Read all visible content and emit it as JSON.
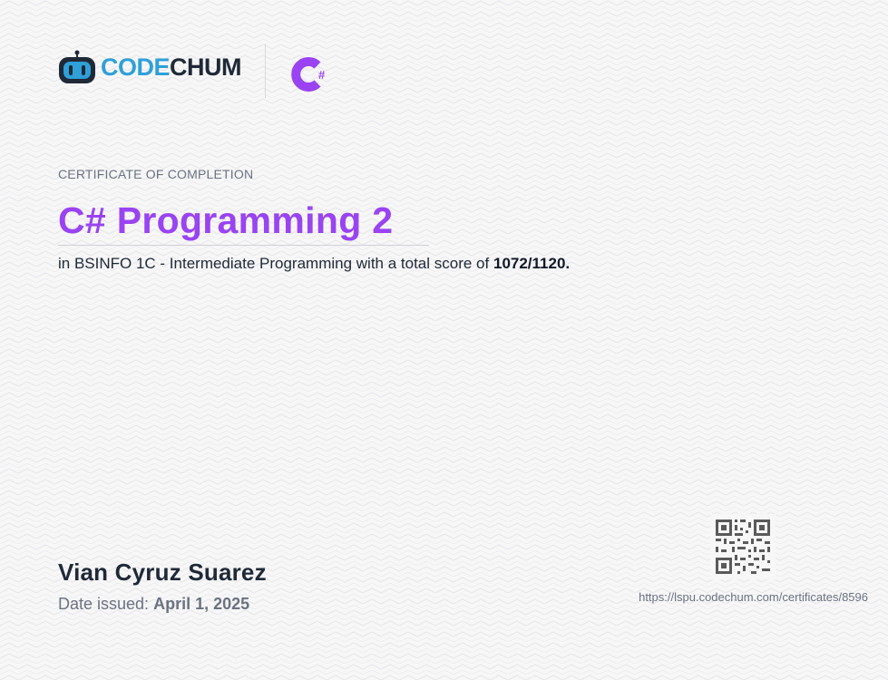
{
  "brand": {
    "name_part1": "CODE",
    "name_part2": "CHUM",
    "course_icon_letter": "C",
    "course_icon_symbol": "#"
  },
  "certificate": {
    "label": "CERTIFICATE OF COMPLETION",
    "course_title": "C# Programming 2",
    "description_prefix": "in BSINFO 1C - Intermediate Programming with a total score of",
    "score": "1072/1120.",
    "recipient_name": "Vian Cyruz Suarez",
    "date_label": "Date issued:",
    "date_value": "April 1, 2025",
    "verify_url": "https://lspu.codechum.com/certificates/8596"
  },
  "colors": {
    "brand_blue": "#2fa0d8",
    "brand_dark": "#1f2937",
    "accent_purple": "#9a43f2",
    "muted_text": "#6b7280"
  },
  "icons": [
    "codechum-robot-icon",
    "csharp-icon",
    "qr-code-icon"
  ]
}
